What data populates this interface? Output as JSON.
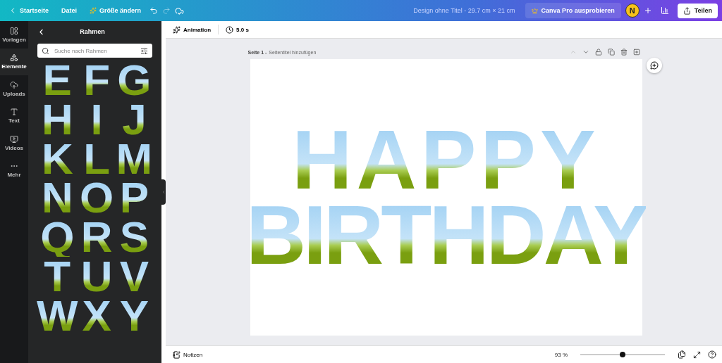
{
  "topbar": {
    "back": "Startseite",
    "file": "Datei",
    "resize": "Größe ändern",
    "design_title": "Design ohne Titel - 29.7 cm × 21 cm",
    "pro": "Canva Pro ausprobieren",
    "avatar": "N",
    "share": "Teilen"
  },
  "nav": [
    {
      "label": "Vorlagen",
      "kind": "templates",
      "selected": false
    },
    {
      "label": "Elemente",
      "kind": "elements",
      "selected": true
    },
    {
      "label": "Uploads",
      "kind": "uploads",
      "selected": false
    },
    {
      "label": "Text",
      "kind": "text",
      "selected": false
    },
    {
      "label": "Videos",
      "kind": "videos",
      "selected": false
    },
    {
      "label": "Mehr",
      "kind": "more",
      "selected": false
    }
  ],
  "panel": {
    "title": "Rahmen",
    "search": {
      "placeholder": "Suche nach Rahmen"
    },
    "letters": [
      "E",
      "F",
      "G",
      "H",
      "I",
      "J",
      "K",
      "L",
      "M",
      "N",
      "O",
      "P",
      "Q",
      "R",
      "S",
      "T",
      "U",
      "V",
      "W",
      "X",
      "Y"
    ]
  },
  "toolbar": {
    "animation": "Animation",
    "duration": "5.0 s"
  },
  "page": {
    "label": "Seite 1 -",
    "subtitle": "Seitentitel hinzufügen",
    "lines": [
      "HAPPY",
      "BIRTHDAY"
    ]
  },
  "footer": {
    "notes": "Notizen",
    "zoom": "93 %",
    "level": 0.5
  }
}
